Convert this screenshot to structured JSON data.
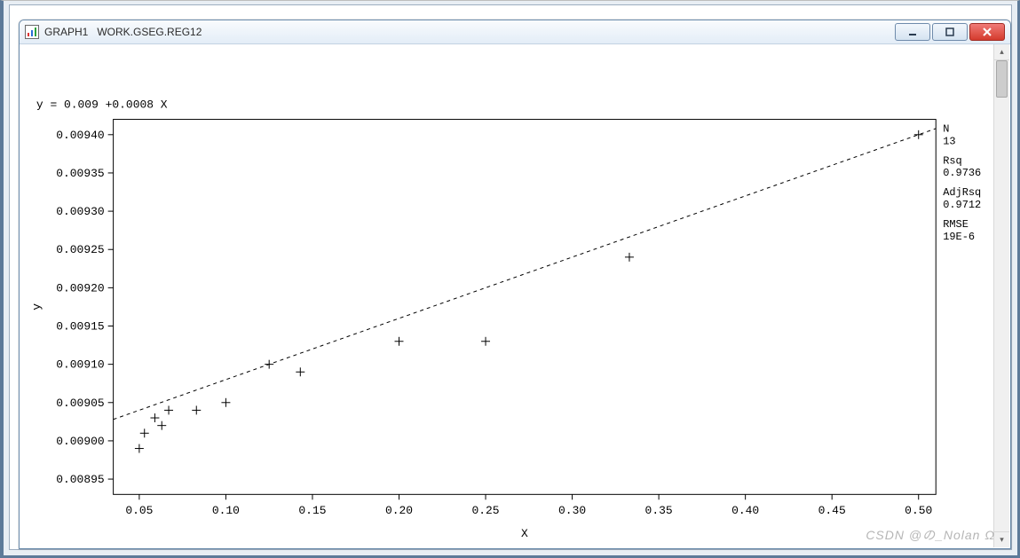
{
  "window": {
    "title": "GRAPH1   WORK.GSEG.REG12",
    "controls": {
      "min": "minimize",
      "max": "maximize",
      "close": "close"
    }
  },
  "equation": "y = 0.009 +0.0008 X",
  "axes": {
    "xlabel": "X",
    "ylabel": "y"
  },
  "stats": {
    "n_label": "N",
    "n": "13",
    "rsq_label": "Rsq",
    "rsq": "0.9736",
    "adjrsq_label": "AdjRsq",
    "adjrsq": "0.9712",
    "rmse_label": "RMSE",
    "rmse": "19E-6"
  },
  "watermark": "CSDN @の_Nolan  Ω",
  "chart_data": {
    "type": "scatter",
    "title": "",
    "xlabel": "X",
    "ylabel": "y",
    "x_ticks": [
      0.05,
      0.1,
      0.15,
      0.2,
      0.25,
      0.3,
      0.35,
      0.4,
      0.45,
      0.5
    ],
    "y_ticks": [
      0.00895,
      0.009,
      0.00905,
      0.0091,
      0.00915,
      0.0092,
      0.00925,
      0.0093,
      0.00935,
      0.0094
    ],
    "x_tick_labels": [
      "0.05",
      "0.10",
      "0.15",
      "0.20",
      "0.25",
      "0.30",
      "0.35",
      "0.40",
      "0.45",
      "0.50"
    ],
    "y_tick_labels": [
      "0.00895",
      "0.00900",
      "0.00905",
      "0.00910",
      "0.00915",
      "0.00920",
      "0.00925",
      "0.00930",
      "0.00935",
      "0.00940"
    ],
    "points": [
      {
        "x": 0.05,
        "y": 0.00899
      },
      {
        "x": 0.053,
        "y": 0.00901
      },
      {
        "x": 0.059,
        "y": 0.00903
      },
      {
        "x": 0.063,
        "y": 0.00902
      },
      {
        "x": 0.067,
        "y": 0.00904
      },
      {
        "x": 0.083,
        "y": 0.00904
      },
      {
        "x": 0.1,
        "y": 0.00905
      },
      {
        "x": 0.125,
        "y": 0.0091
      },
      {
        "x": 0.143,
        "y": 0.00909
      },
      {
        "x": 0.2,
        "y": 0.00913
      },
      {
        "x": 0.25,
        "y": 0.00913
      },
      {
        "x": 0.333,
        "y": 0.00924
      },
      {
        "x": 0.5,
        "y": 0.0094
      }
    ],
    "regression": {
      "intercept": 0.009,
      "slope": 0.0008
    },
    "xlim": [
      0.035,
      0.51
    ],
    "ylim": [
      0.00893,
      0.00942
    ]
  }
}
